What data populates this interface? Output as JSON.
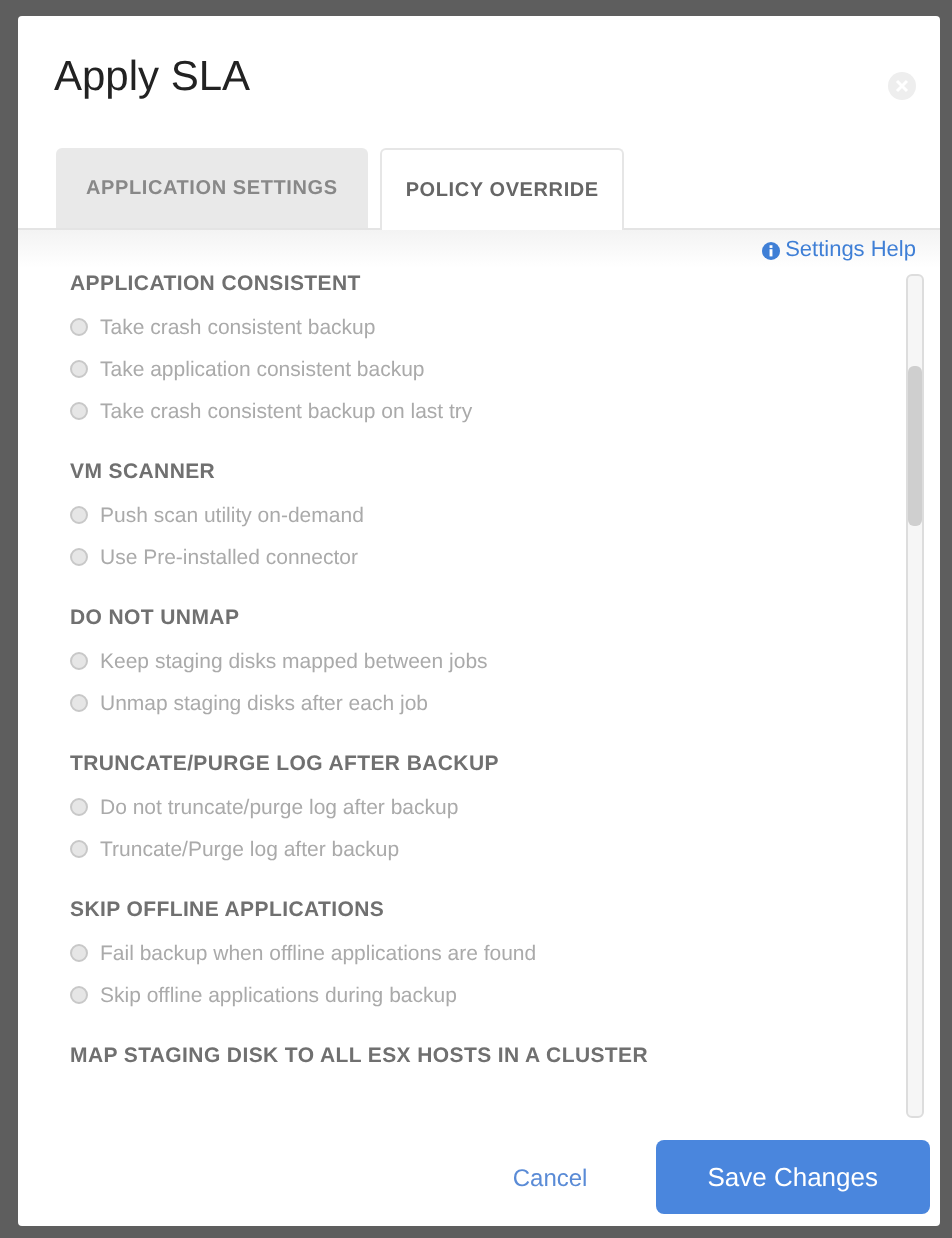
{
  "dialog": {
    "title": "Apply SLA"
  },
  "tabs": [
    {
      "label": "APPLICATION SETTINGS",
      "selected": false
    },
    {
      "label": "POLICY OVERRIDE",
      "selected": true
    }
  ],
  "help_link": "Settings Help",
  "sections": [
    {
      "heading": "APPLICATION CONSISTENT",
      "options": [
        {
          "label": "Take crash consistent backup",
          "selected": false,
          "disabled": true
        },
        {
          "label": "Take application consistent backup",
          "selected": false,
          "disabled": true
        },
        {
          "label": "Take crash consistent backup on last try",
          "selected": false,
          "disabled": true
        }
      ]
    },
    {
      "heading": "VM SCANNER",
      "options": [
        {
          "label": "Push scan utility on-demand",
          "selected": false,
          "disabled": true
        },
        {
          "label": "Use Pre-installed connector",
          "selected": false,
          "disabled": true
        }
      ]
    },
    {
      "heading": "DO NOT UNMAP",
      "options": [
        {
          "label": "Keep staging disks mapped between jobs",
          "selected": false,
          "disabled": true
        },
        {
          "label": "Unmap staging disks after each job",
          "selected": false,
          "disabled": true
        }
      ]
    },
    {
      "heading": "TRUNCATE/PURGE LOG AFTER BACKUP",
      "options": [
        {
          "label": "Do not truncate/purge log after backup",
          "selected": false,
          "disabled": true
        },
        {
          "label": "Truncate/Purge log after backup",
          "selected": false,
          "disabled": true
        }
      ]
    },
    {
      "heading": "SKIP OFFLINE APPLICATIONS",
      "options": [
        {
          "label": "Fail backup when offline applications are found",
          "selected": false,
          "disabled": true
        },
        {
          "label": "Skip offline applications during backup",
          "selected": false,
          "disabled": true
        }
      ]
    },
    {
      "heading": "MAP STAGING DISK TO ALL ESX HOSTS IN A CLUSTER"
    }
  ],
  "buttons": {
    "cancel": "Cancel",
    "save": "Save Changes"
  }
}
